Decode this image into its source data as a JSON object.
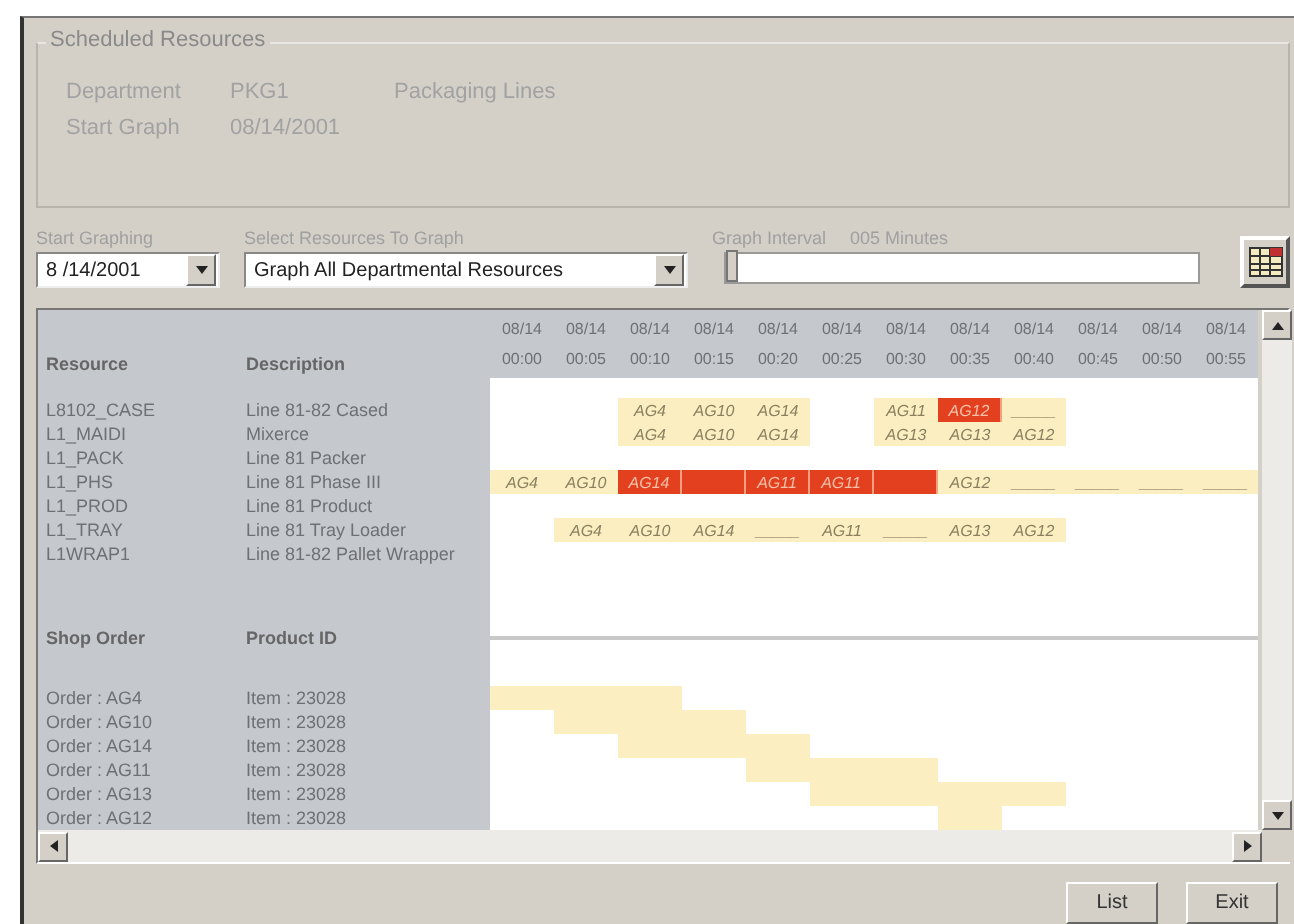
{
  "group": {
    "title": "Scheduled Resources",
    "fields": [
      {
        "label": "Department",
        "value": "PKG1",
        "extra": "Packaging Lines"
      },
      {
        "label": "Start Graph",
        "value": "08/14/2001"
      }
    ]
  },
  "controls": {
    "start_label": "Start Graphing",
    "start_value": "8 /14/2001",
    "resources_label": "Select Resources To Graph",
    "resources_value": "Graph All Departmental Resources",
    "interval_label": "Graph Interval",
    "interval_value": "005 Minutes",
    "interval_slider": {
      "level": 0.0
    }
  },
  "grid": {
    "columns": [
      {
        "date": "08/14",
        "time": "00:00"
      },
      {
        "date": "08/14",
        "time": "00:05"
      },
      {
        "date": "08/14",
        "time": "00:10"
      },
      {
        "date": "08/14",
        "time": "00:15"
      },
      {
        "date": "08/14",
        "time": "00:20"
      },
      {
        "date": "08/14",
        "time": "00:25"
      },
      {
        "date": "08/14",
        "time": "00:30"
      },
      {
        "date": "08/14",
        "time": "00:35"
      },
      {
        "date": "08/14",
        "time": "00:40"
      },
      {
        "date": "08/14",
        "time": "00:45"
      },
      {
        "date": "08/14",
        "time": "00:50"
      },
      {
        "date": "08/14",
        "time": "00:55"
      }
    ],
    "resource_headers": [
      "Resource",
      "Description"
    ],
    "resources": [
      {
        "name": "L8102_CASE",
        "description": "Line 81-82 Cased",
        "cells": [
          {
            "kind": "empty"
          },
          {
            "kind": "empty"
          },
          {
            "kind": "booked",
            "label": "AG4"
          },
          {
            "kind": "booked",
            "label": "AG10"
          },
          {
            "kind": "booked",
            "label": "AG14"
          },
          {
            "kind": "empty"
          },
          {
            "kind": "booked",
            "label": "AG11"
          },
          {
            "kind": "conflict",
            "label": "AG12"
          },
          {
            "kind": "booked",
            "label": "_____"
          },
          {
            "kind": "empty"
          },
          {
            "kind": "empty"
          },
          {
            "kind": "empty"
          }
        ]
      },
      {
        "name": "L1_MAIDI",
        "description": "Mixerce",
        "cells": [
          {
            "kind": "empty"
          },
          {
            "kind": "empty"
          },
          {
            "kind": "booked",
            "label": "AG4"
          },
          {
            "kind": "booked",
            "label": "AG10"
          },
          {
            "kind": "booked",
            "label": "AG14"
          },
          {
            "kind": "empty"
          },
          {
            "kind": "booked",
            "label": "AG13"
          },
          {
            "kind": "booked",
            "label": "AG13"
          },
          {
            "kind": "booked",
            "label": "AG12"
          },
          {
            "kind": "empty"
          },
          {
            "kind": "empty"
          },
          {
            "kind": "empty"
          }
        ]
      },
      {
        "name": "L1_PACK",
        "description": "Line 81 Packer"
      },
      {
        "name": "L1_PHS",
        "description": "Line 81 Phase III",
        "cells": [
          {
            "kind": "booked",
            "label": "AG4"
          },
          {
            "kind": "booked",
            "label": "AG10"
          },
          {
            "kind": "conflict",
            "label": "AG14"
          },
          {
            "kind": "conflict"
          },
          {
            "kind": "conflict",
            "label": "AG11"
          },
          {
            "kind": "conflict",
            "label": "AG11"
          },
          {
            "kind": "conflict"
          },
          {
            "kind": "booked",
            "label": "AG12"
          },
          {
            "kind": "booked",
            "label": "_____"
          },
          {
            "kind": "booked",
            "label": "_____"
          },
          {
            "kind": "booked",
            "label": "_____"
          },
          {
            "kind": "booked",
            "label": "_____"
          }
        ]
      },
      {
        "name": "L1_PROD",
        "description": "Line 81 Product"
      },
      {
        "name": "L1_TRAY",
        "description": "Line 81 Tray Loader",
        "cells": [
          {
            "kind": "empty"
          },
          {
            "kind": "booked",
            "label": "AG4"
          },
          {
            "kind": "booked",
            "label": "AG10"
          },
          {
            "kind": "booked",
            "label": "AG14"
          },
          {
            "kind": "booked",
            "label": "_____"
          },
          {
            "kind": "booked",
            "label": "AG11"
          },
          {
            "kind": "booked",
            "label": "_____"
          },
          {
            "kind": "booked",
            "label": "AG13"
          },
          {
            "kind": "booked",
            "label": "AG12"
          },
          {
            "kind": "empty"
          },
          {
            "kind": "empty"
          },
          {
            "kind": "empty"
          }
        ]
      },
      {
        "name": "L1WRAP1",
        "description": "Line 81-82 Pallet Wrapper"
      }
    ],
    "order_headers": [
      "Shop Order",
      "Product ID"
    ],
    "orders": [
      {
        "order": "Order : AG4",
        "product": "Item : 23028",
        "booked": [
          true,
          true,
          true,
          false,
          false,
          false,
          false,
          false,
          false,
          false,
          false,
          false
        ]
      },
      {
        "order": "Order : AG10",
        "product": "Item : 23028",
        "booked": [
          false,
          true,
          true,
          true,
          false,
          false,
          false,
          false,
          false,
          false,
          false,
          false
        ]
      },
      {
        "order": "Order : AG14",
        "product": "Item : 23028",
        "booked": [
          false,
          false,
          true,
          true,
          true,
          false,
          false,
          false,
          false,
          false,
          false,
          false
        ]
      },
      {
        "order": "Order : AG11",
        "product": "Item : 23028",
        "booked": [
          false,
          false,
          false,
          false,
          true,
          true,
          true,
          false,
          false,
          false,
          false,
          false
        ]
      },
      {
        "order": "Order : AG13",
        "product": "Item : 23028",
        "booked": [
          false,
          false,
          false,
          false,
          false,
          true,
          true,
          true,
          true,
          false,
          false,
          false
        ]
      },
      {
        "order": "Order : AG12",
        "product": "Item : 23028",
        "booked": [
          false,
          false,
          false,
          false,
          false,
          false,
          false,
          true,
          false,
          false,
          false,
          false
        ]
      }
    ]
  },
  "buttons": [
    "List",
    "Exit"
  ]
}
